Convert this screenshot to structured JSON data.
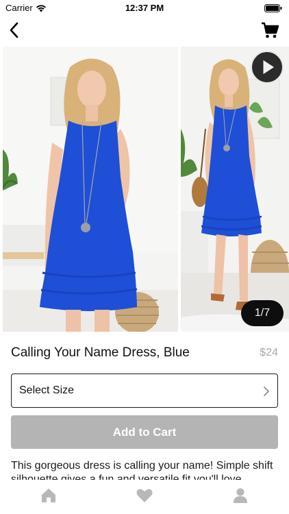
{
  "status_bar": {
    "carrier": "Carrier",
    "time": "12:37 PM"
  },
  "nav": {
    "back_icon": "chevron-left-icon",
    "cart_icon": "cart-icon"
  },
  "gallery": {
    "counter": "1/7",
    "play_icon": "play-icon"
  },
  "product": {
    "title": "Calling Your Name Dress, Blue",
    "price": "$24",
    "size_select_label": "Select Size",
    "add_to_cart_label": "Add to Cart",
    "description": "This gorgeous dress is calling your name! Simple shift silhouette gives a fun and versatile fit you'll love"
  },
  "tabs": [
    {
      "icon": "home-icon"
    },
    {
      "icon": "heart-icon"
    },
    {
      "icon": "person-icon"
    }
  ],
  "colors": {
    "dress_blue": "#1f4fd6",
    "button_disabled": "#b4b4b4",
    "price_gray": "#a8a8a8",
    "tab_icon_gray": "#b8b8b8"
  }
}
